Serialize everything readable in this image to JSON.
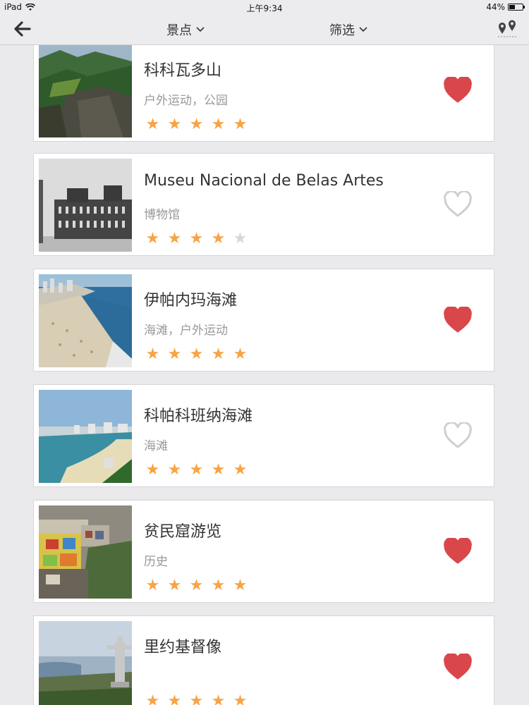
{
  "status_bar": {
    "device": "iPad",
    "time": "上午9:34",
    "battery_percent": "44%",
    "battery_level": 0.44
  },
  "nav": {
    "back_icon": "back-arrow-icon",
    "sights_label": "景点",
    "filter_label": "筛选",
    "map_icon": "map-pins-icon"
  },
  "colors": {
    "star_on": "#f6a445",
    "star_off": "#d7d7d9",
    "heart_filled": "#d9474b",
    "heart_outline": "#cfcfd2"
  },
  "places": [
    {
      "name": "科科瓦多山",
      "category": "户外运动，公园",
      "rating": 5,
      "favorite": true,
      "thumb": "mountain"
    },
    {
      "name": "Museu Nacional de Belas Artes",
      "category": "博物馆",
      "rating": 4,
      "favorite": false,
      "thumb": "museum"
    },
    {
      "name": "伊帕内玛海滩",
      "category": "海滩，户外运动",
      "rating": 5,
      "favorite": true,
      "thumb": "beach"
    },
    {
      "name": "科帕科班纳海滩",
      "category": "海滩",
      "rating": 5,
      "favorite": false,
      "thumb": "bay"
    },
    {
      "name": "贫民窟游览",
      "category": "历史",
      "rating": 5,
      "favorite": true,
      "thumb": "favela"
    },
    {
      "name": "里约基督像",
      "category": "",
      "rating": 5,
      "favorite": true,
      "thumb": "christ"
    }
  ]
}
